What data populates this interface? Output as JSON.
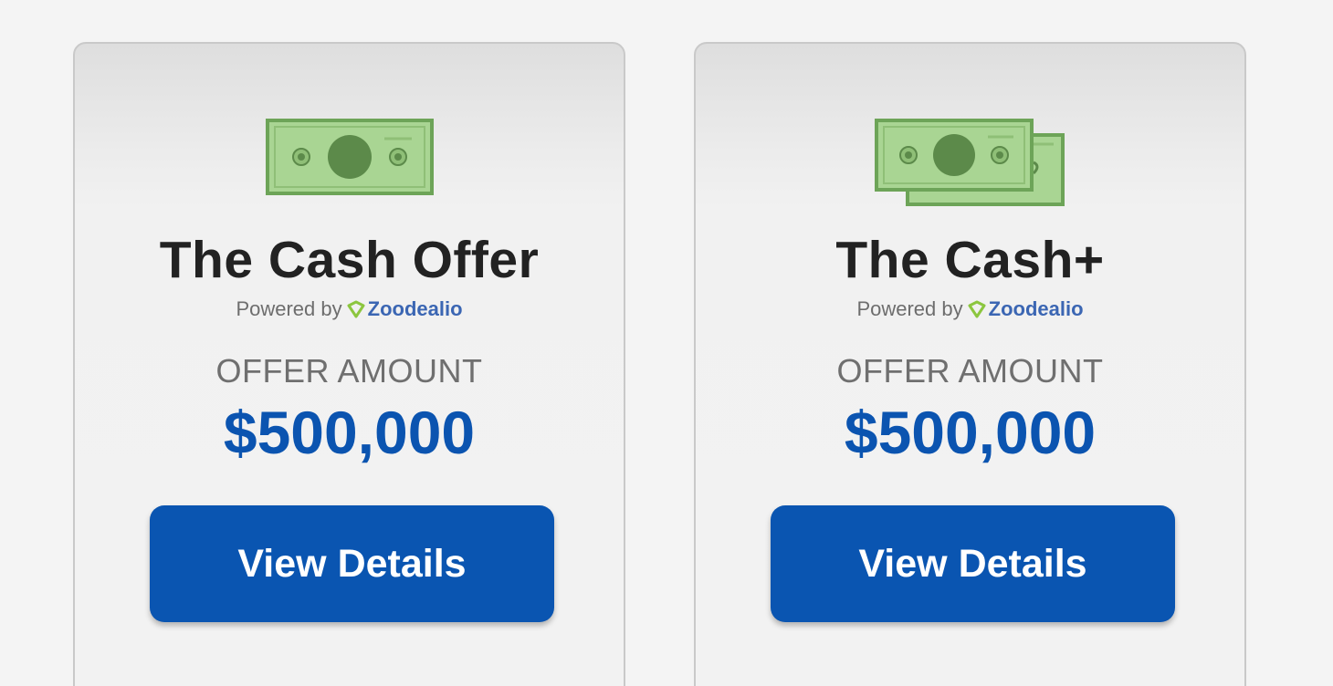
{
  "cards": [
    {
      "icon": "single-bill-icon",
      "title": "The Cash Offer",
      "powered_by": "Powered by",
      "brand": "Zoodealio",
      "offer_label": "OFFER AMOUNT",
      "offer_amount": "$500,000",
      "button_label": "View Details"
    },
    {
      "icon": "double-bills-icon",
      "title": "The Cash+",
      "powered_by": "Powered by",
      "brand": "Zoodealio",
      "offer_label": "OFFER AMOUNT",
      "offer_amount": "$500,000",
      "button_label": "View Details"
    }
  ],
  "colors": {
    "accent_blue": "#0a55b1",
    "amount_blue": "#0b54b0",
    "bill_green_light": "#a9d593",
    "bill_green_dark": "#5f8a4a",
    "brand_blue": "#3b66b3"
  }
}
